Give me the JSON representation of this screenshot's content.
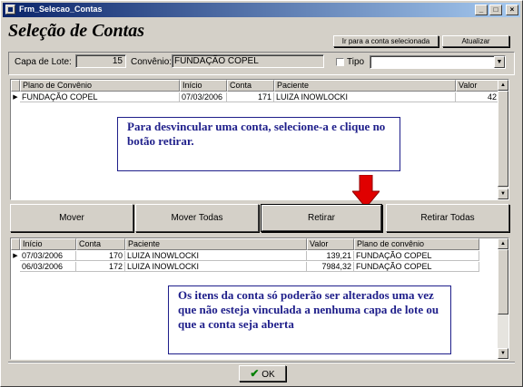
{
  "window": {
    "title": "Frm_Selecao_Contas",
    "minimize": "_",
    "maximize": "□",
    "close": "×"
  },
  "heading": "Seleção de Contas",
  "toolbar": {
    "goto_label": "Ir para a conta selecionada",
    "refresh_label": "Atualizar"
  },
  "filters": {
    "capa_label": "Capa de Lote:",
    "capa_value": "15",
    "convenio_label": "Convênio:",
    "convenio_value": "FUNDAÇÃO  COPEL",
    "tipo_label": "Tipo",
    "tipo_value": ""
  },
  "top_grid": {
    "columns": [
      "Plano de Convênio",
      "Início",
      "Conta",
      "Paciente",
      "Valor"
    ],
    "rows": [
      {
        "plano": "FUNDAÇÃO COPEL",
        "inicio": "07/03/2006",
        "conta": "171",
        "paciente": "LUIZA INOWLOCKI",
        "valor": "42"
      }
    ]
  },
  "callout_top": "Para desvincular uma conta, selecione-a e clique no botão retirar.",
  "actions": {
    "mover": "Mover",
    "mover_todas": "Mover Todas",
    "retirar": "Retirar",
    "retirar_todas": "Retirar Todas"
  },
  "bottom_grid": {
    "columns": [
      "Início",
      "Conta",
      "Paciente",
      "Valor",
      "Plano de convênio"
    ],
    "rows": [
      {
        "inicio": "07/03/2006",
        "conta": "170",
        "paciente": "LUIZA INOWLOCKI",
        "valor": "139,21",
        "plano": "FUNDAÇÃO COPEL"
      },
      {
        "inicio": "06/03/2006",
        "conta": "172",
        "paciente": "LUIZA INOWLOCKI",
        "valor": "7984,32",
        "plano": "FUNDAÇÃO COPEL"
      }
    ]
  },
  "callout_bottom": "Os itens da conta só poderão ser alterados uma vez que não esteja vinculada a nenhuma capa de lote ou que a conta seja aberta",
  "ok_label": "OK",
  "colors": {
    "callout_text": "#1e1e8a",
    "arrow": "#e00000",
    "ok_check": "#008000"
  }
}
